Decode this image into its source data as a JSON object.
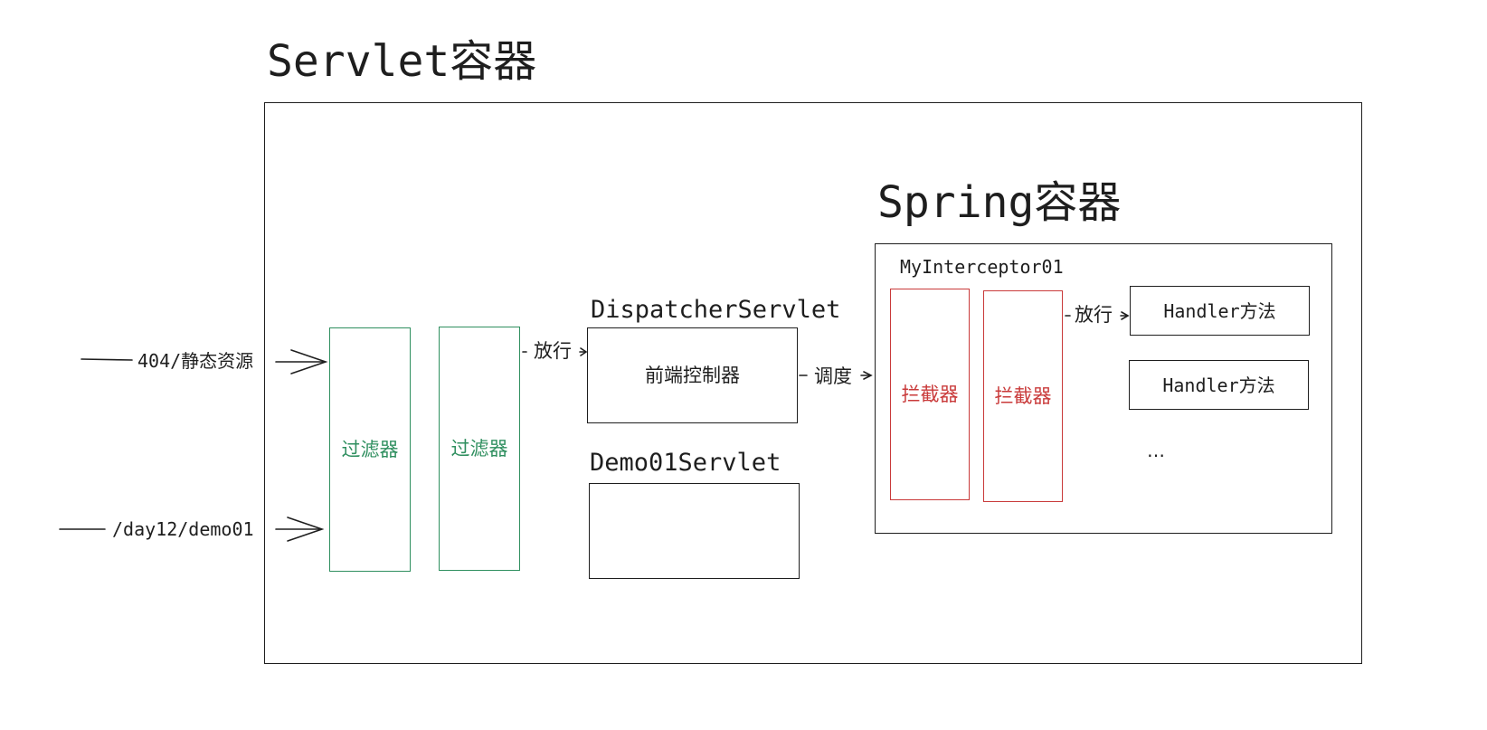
{
  "servlet_container": {
    "title": "Servlet容器"
  },
  "spring_container": {
    "title": "Spring容器",
    "interceptor_name": "MyInterceptor01"
  },
  "inputs": {
    "static_resource": "404/静态资源",
    "demo_path": "/day12/demo01"
  },
  "filters": [
    {
      "label": "过滤器"
    },
    {
      "label": "过滤器"
    }
  ],
  "arrows": {
    "pass_filter": "放行",
    "dispatch": "调度",
    "pass_interceptor": "放行"
  },
  "dispatcher_servlet": {
    "title": "DispatcherServlet",
    "label": "前端控制器"
  },
  "demo_servlet": {
    "title": "Demo01Servlet"
  },
  "interceptors": [
    {
      "label": "拦截器"
    },
    {
      "label": "拦截器"
    }
  ],
  "handlers": [
    {
      "label": "Handler方法"
    },
    {
      "label": "Handler方法"
    }
  ],
  "ellipsis": "…",
  "colors": {
    "filter": "#2f8f5f",
    "interceptor": "#c93a3a",
    "stroke": "#1e1e1e"
  }
}
